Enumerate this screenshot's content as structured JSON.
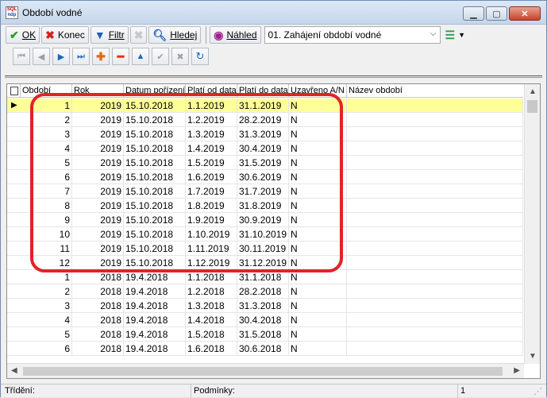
{
  "window": {
    "title": "Období vodné",
    "icon_name": "sql-app-icon",
    "icon_text_top": "SQL",
    "icon_text_bottom": "ndp"
  },
  "toolbar": {
    "ok_label": "OK",
    "close_label": "Konec",
    "filter_label": "Filtr",
    "search_label": "Hledej",
    "preview_label": "Náhled",
    "action_select_value": "01. Zahájení období vodné"
  },
  "grid": {
    "columns": [
      "Období",
      "Rok",
      "Datum pořízení",
      "Platí od data",
      "Platí do data",
      "Uzavřeno A/N",
      "Název období"
    ],
    "rows": [
      {
        "obdobi": "1",
        "rok": "2019",
        "porizeni": "15.10.2018",
        "od": "1.1.2019",
        "do": "31.1.2019",
        "uzavreno": "N",
        "nazev": ""
      },
      {
        "obdobi": "2",
        "rok": "2019",
        "porizeni": "15.10.2018",
        "od": "1.2.2019",
        "do": "28.2.2019",
        "uzavreno": "N",
        "nazev": ""
      },
      {
        "obdobi": "3",
        "rok": "2019",
        "porizeni": "15.10.2018",
        "od": "1.3.2019",
        "do": "31.3.2019",
        "uzavreno": "N",
        "nazev": ""
      },
      {
        "obdobi": "4",
        "rok": "2019",
        "porizeni": "15.10.2018",
        "od": "1.4.2019",
        "do": "30.4.2019",
        "uzavreno": "N",
        "nazev": ""
      },
      {
        "obdobi": "5",
        "rok": "2019",
        "porizeni": "15.10.2018",
        "od": "1.5.2019",
        "do": "31.5.2019",
        "uzavreno": "N",
        "nazev": ""
      },
      {
        "obdobi": "6",
        "rok": "2019",
        "porizeni": "15.10.2018",
        "od": "1.6.2019",
        "do": "30.6.2019",
        "uzavreno": "N",
        "nazev": ""
      },
      {
        "obdobi": "7",
        "rok": "2019",
        "porizeni": "15.10.2018",
        "od": "1.7.2019",
        "do": "31.7.2019",
        "uzavreno": "N",
        "nazev": ""
      },
      {
        "obdobi": "8",
        "rok": "2019",
        "porizeni": "15.10.2018",
        "od": "1.8.2019",
        "do": "31.8.2019",
        "uzavreno": "N",
        "nazev": ""
      },
      {
        "obdobi": "9",
        "rok": "2019",
        "porizeni": "15.10.2018",
        "od": "1.9.2019",
        "do": "30.9.2019",
        "uzavreno": "N",
        "nazev": ""
      },
      {
        "obdobi": "10",
        "rok": "2019",
        "porizeni": "15.10.2018",
        "od": "1.10.2019",
        "do": "31.10.2019",
        "uzavreno": "N",
        "nazev": ""
      },
      {
        "obdobi": "11",
        "rok": "2019",
        "porizeni": "15.10.2018",
        "od": "1.11.2019",
        "do": "30.11.2019",
        "uzavreno": "N",
        "nazev": ""
      },
      {
        "obdobi": "12",
        "rok": "2019",
        "porizeni": "15.10.2018",
        "od": "1.12.2019",
        "do": "31.12.2019",
        "uzavreno": "N",
        "nazev": ""
      },
      {
        "obdobi": "1",
        "rok": "2018",
        "porizeni": "19.4.2018",
        "od": "1.1.2018",
        "do": "31.1.2018",
        "uzavreno": "N",
        "nazev": ""
      },
      {
        "obdobi": "2",
        "rok": "2018",
        "porizeni": "19.4.2018",
        "od": "1.2.2018",
        "do": "28.2.2018",
        "uzavreno": "N",
        "nazev": ""
      },
      {
        "obdobi": "3",
        "rok": "2018",
        "porizeni": "19.4.2018",
        "od": "1.3.2018",
        "do": "31.3.2018",
        "uzavreno": "N",
        "nazev": ""
      },
      {
        "obdobi": "4",
        "rok": "2018",
        "porizeni": "19.4.2018",
        "od": "1.4.2018",
        "do": "30.4.2018",
        "uzavreno": "N",
        "nazev": ""
      },
      {
        "obdobi": "5",
        "rok": "2018",
        "porizeni": "19.4.2018",
        "od": "1.5.2018",
        "do": "31.5.2018",
        "uzavreno": "N",
        "nazev": ""
      },
      {
        "obdobi": "6",
        "rok": "2018",
        "porizeni": "19.4.2018",
        "od": "1.6.2018",
        "do": "30.6.2018",
        "uzavreno": "N",
        "nazev": ""
      }
    ],
    "selected_row": 0
  },
  "status": {
    "sort_label": "Třídění:",
    "conditions_label": "Podmínky:",
    "count": "1"
  },
  "colors": {
    "selected_row": "#ffff99",
    "highlight_frame": "#e32227"
  }
}
